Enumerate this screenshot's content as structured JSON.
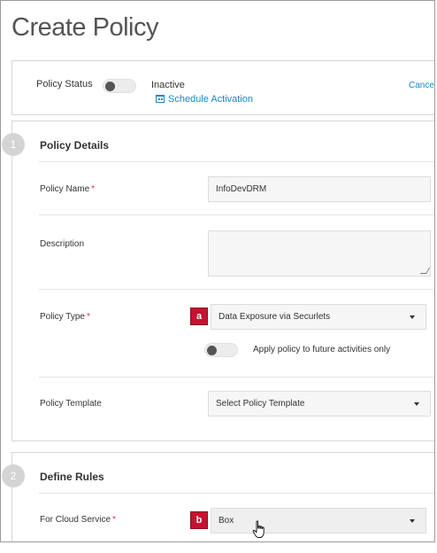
{
  "page": {
    "title": "Create Policy"
  },
  "status": {
    "label": "Policy Status",
    "state": "Inactive",
    "schedule_link": "Schedule Activation",
    "cancel": "Cancel"
  },
  "details": {
    "step": "1",
    "title": "Policy Details",
    "name_label": "Policy Name",
    "name_value": "InfoDevDRM",
    "required_mark": "*",
    "description_label": "Description",
    "description_value": "",
    "type_label": "Policy Type",
    "type_badge": "a",
    "type_value": "Data Exposure via Securlets",
    "future_toggle_label": "Apply policy to future activities only",
    "template_label": "Policy Template",
    "template_value": "Select Policy Template"
  },
  "rules": {
    "step": "2",
    "title": "Define Rules",
    "cloud_label": "For Cloud Service",
    "cloud_badge": "b",
    "cloud_value": "Box"
  },
  "colors": {
    "link": "#1a87c9",
    "required": "#d9303e",
    "badge": "#c4122f"
  }
}
